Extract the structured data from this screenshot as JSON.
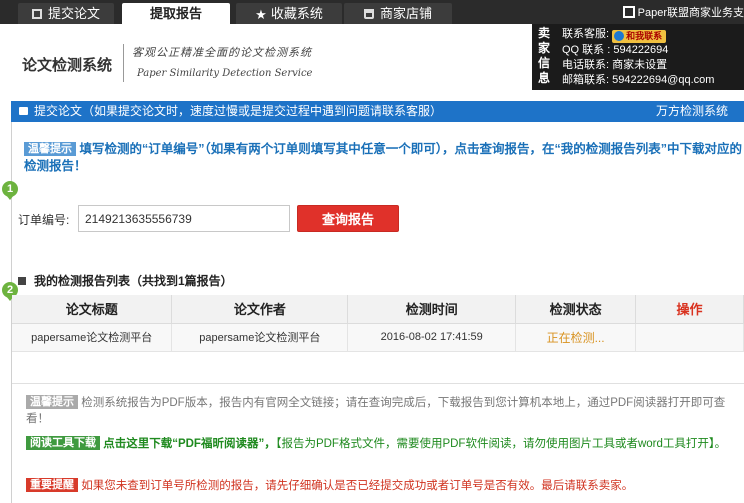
{
  "tabs": [
    {
      "label": "提交论文",
      "icon": "document-icon",
      "active": false
    },
    {
      "label": "提取报告",
      "icon": "none",
      "active": true
    },
    {
      "label": "收藏系统",
      "icon": "star-icon",
      "active": false
    },
    {
      "label": "商家店铺",
      "icon": "cart-icon",
      "active": false
    }
  ],
  "site_name": "Paper联盟商家业务支",
  "header": {
    "logo": "论文检测系统",
    "slogan": "客观公正精准全面的论文检测系统",
    "slogan_en": "Paper Similarity Detection Service"
  },
  "seller": {
    "vertical_label": "卖家信息",
    "rows": [
      {
        "label": "联系客服:",
        "value": "和我联系"
      },
      {
        "label": "QQ 联系 :",
        "value": "594222694"
      },
      {
        "label": "电话联系:",
        "value": "商家未设置"
      },
      {
        "label": "邮箱联系:",
        "value": "594222694@qq.com"
      }
    ]
  },
  "banner": {
    "text": "提交论文（如果提交论文时，速度过慢或是提交过程中遇到问题请联系客服）",
    "right": "万方检测系统"
  },
  "tip1": {
    "tag": "温馨提示",
    "text": "填写检测的“订单编号”（如果有两个订单则填写其中任意一个即可），点击查询报告，在“我的检测报告列表”中下载对应的检测报告！"
  },
  "steps": [
    "1",
    "2"
  ],
  "order": {
    "label": "订单编号:",
    "value": "2149213635556739",
    "button": "查询报告"
  },
  "list": {
    "title": "我的检测报告列表（共找到1篇报告）",
    "columns": [
      "论文标题",
      "论文作者",
      "检测时间",
      "检测状态",
      "操作"
    ],
    "rows": [
      {
        "title": "papersame论文检测平台",
        "author": "papersame论文检测平台",
        "time": "2016-08-02 17:41:59",
        "status": "正在检测...",
        "action": ""
      }
    ]
  },
  "notes": [
    {
      "tag": "温馨提示",
      "text": "检测系统报告为PDF版本，报告内有官网全文链接；请在查询完成后，下载报告到您计算机本地上，通过PDF阅读器打开即可查看！"
    },
    {
      "tag": "阅读工具下载",
      "text": "点击这里下载“PDF福昕阅读器”，",
      "rest": "【报告为PDF格式文件，需要使用PDF软件阅读，请勿使用图片工具或者word工具打开】。"
    },
    {
      "tag": "重要提醒",
      "text": "如果您未查到订单号所检测的报告，请先仔细确认是否已经提交成功或者订单号是否有效。最后请联系卖家。"
    }
  ],
  "colors": {
    "accent_blue": "#1e73c8",
    "button_red": "#e0312a",
    "step_green": "#6db33f",
    "status_orange": "#d8921f"
  }
}
